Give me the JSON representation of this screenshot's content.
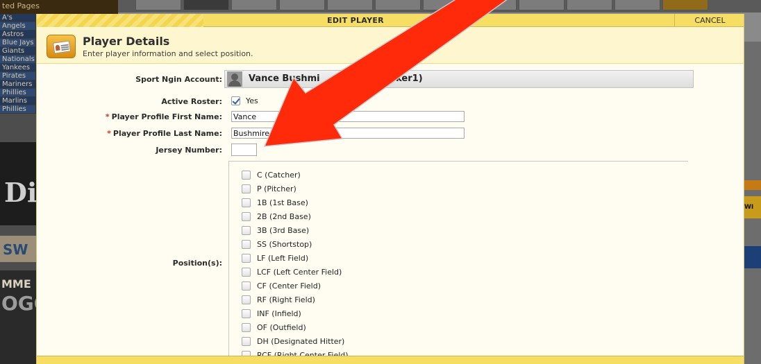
{
  "background": {
    "sidebar_title": "ted Pages",
    "sidebar_links": [
      "A's",
      "Angels",
      "Astros",
      "Blue Jays",
      "Giants",
      "Nationals",
      "Yankees",
      "Pirates",
      "Mariners",
      "Phillies",
      "Marlins",
      "Phillies"
    ],
    "promo_text": "Di",
    "promo_small": "SW",
    "promo2_line1": "MME",
    "promo2_line2": "OGO",
    "right_tab": "WI"
  },
  "modal": {
    "title": "EDIT PLAYER",
    "cancel_label": "CANCEL",
    "section_title": "Player Details",
    "section_subtitle": "Enter player information and select position."
  },
  "form": {
    "account_label": "Sport Ngin Account:",
    "account_name": "Vance Bushmi",
    "account_suffix": "acker1)",
    "active_roster_label": "Active Roster:",
    "active_roster_value": "Yes",
    "first_name_label": "Player Profile First Name:",
    "first_name_value": "Vance",
    "last_name_label": "Player Profile Last Name:",
    "last_name_value": "Bushmire",
    "jersey_label": "Jersey Number:",
    "jersey_value": "",
    "positions_label": "Position(s):",
    "positions": [
      "C (Catcher)",
      "P (Pitcher)",
      "1B (1st Base)",
      "2B (2nd Base)",
      "3B (3rd Base)",
      "SS (Shortstop)",
      "LF (Left Field)",
      "LCF (Left Center Field)",
      "CF (Center Field)",
      "RF (Right Field)",
      "INF (Infield)",
      "OF (Outfield)",
      "DH (Designated Hitter)",
      "RCF (Right Center Field)"
    ]
  },
  "colors": {
    "header_yellow": "#f6dd63",
    "arrow_red": "#ff2a0a",
    "required_star": "#d2371a"
  }
}
